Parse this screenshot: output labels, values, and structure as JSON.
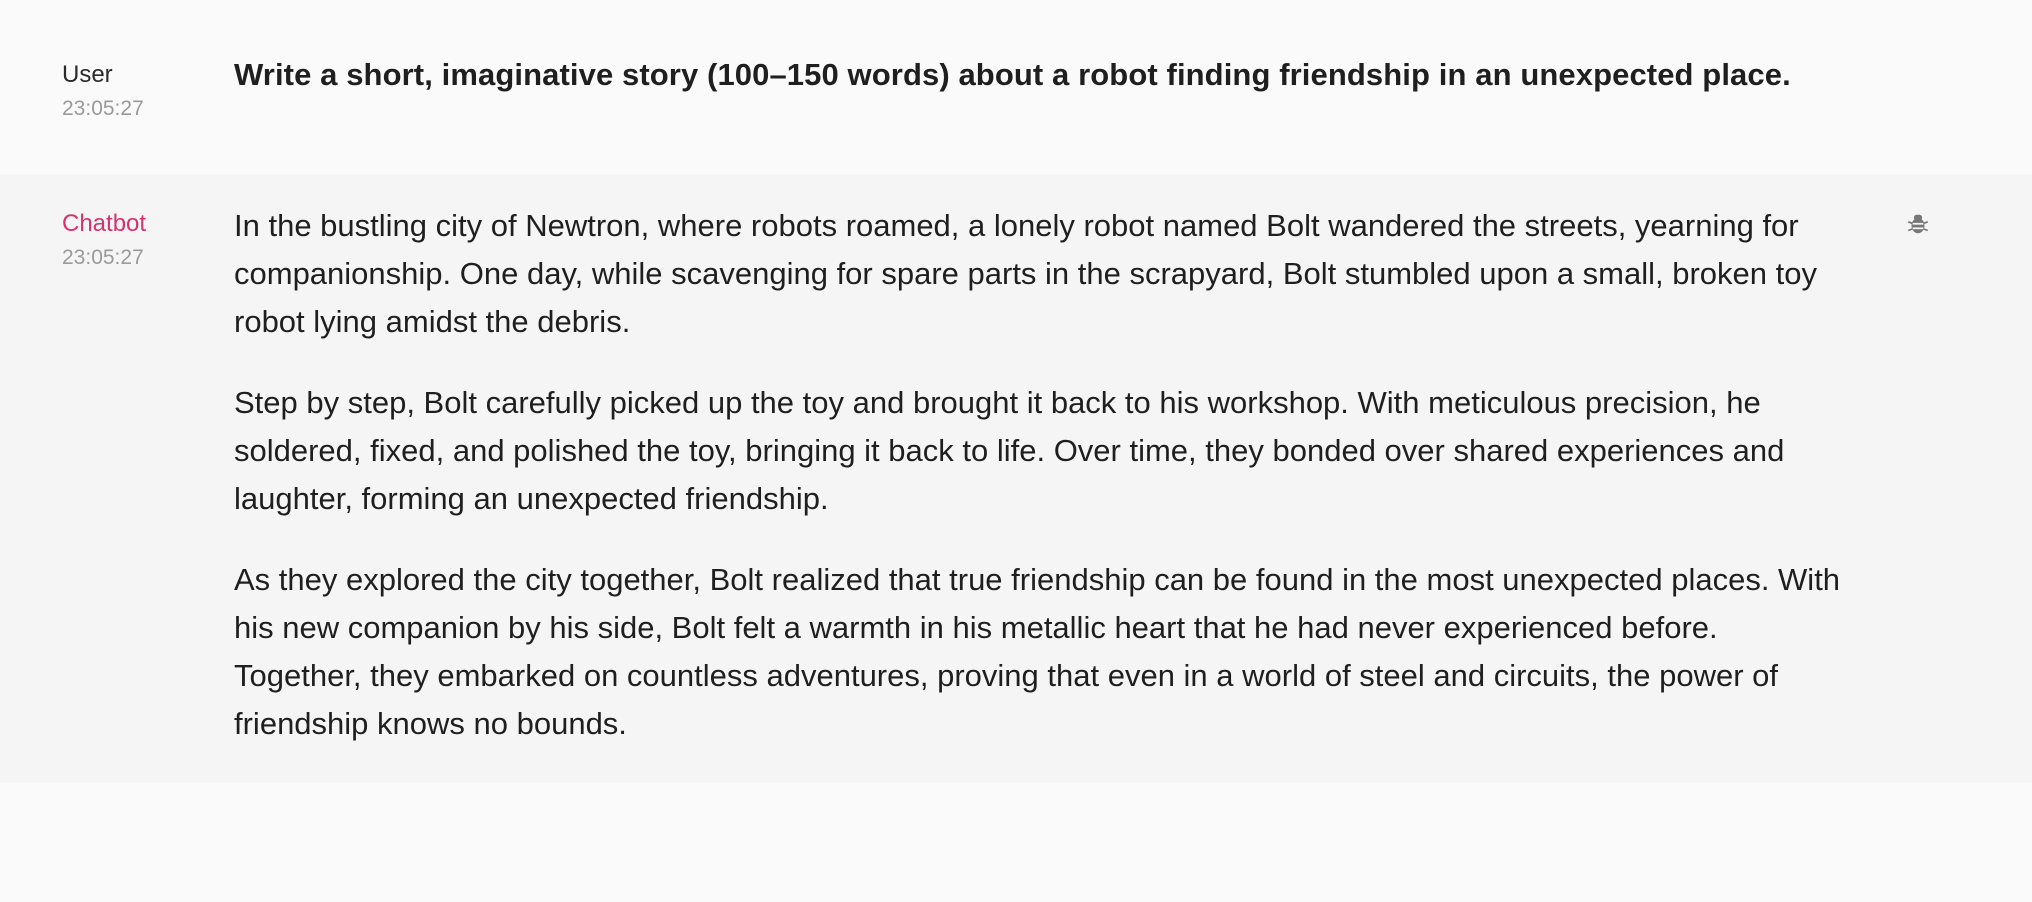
{
  "messages": [
    {
      "role": "user",
      "sender": "User",
      "time": "23:05:27",
      "text": "Write a short, imaginative story (100–150 words) about a robot finding friendship in an unexpected place."
    },
    {
      "role": "bot",
      "sender": "Chatbot",
      "time": "23:05:27",
      "paragraphs": [
        "In the bustling city of Newtron, where robots roamed, a lonely robot named Bolt wandered the streets, yearning for companionship. One day, while scavenging for spare parts in the scrapyard, Bolt stumbled upon a small, broken toy robot lying amidst the debris.",
        "Step by step, Bolt carefully picked up the toy and brought it back to his workshop. With meticulous precision, he soldered, fixed, and polished the toy, bringing it back to life. Over time, they bonded over shared experiences and laughter, forming an unexpected friendship.",
        "As they explored the city together, Bolt realized that true friendship can be found in the most unexpected places. With his new companion by his side, Bolt felt a warmth in his metallic heart that he had never experienced before. Together, they embarked on countless adventures, proving that even in a world of steel and circuits, the power of friendship knows no bounds."
      ],
      "action_icon": "bug-icon"
    }
  ],
  "colors": {
    "bot_name": "#d6336c",
    "user_bg": "#fafafa",
    "bot_bg": "#f5f5f5",
    "timestamp": "#9a9a9a",
    "icon": "#777777"
  }
}
